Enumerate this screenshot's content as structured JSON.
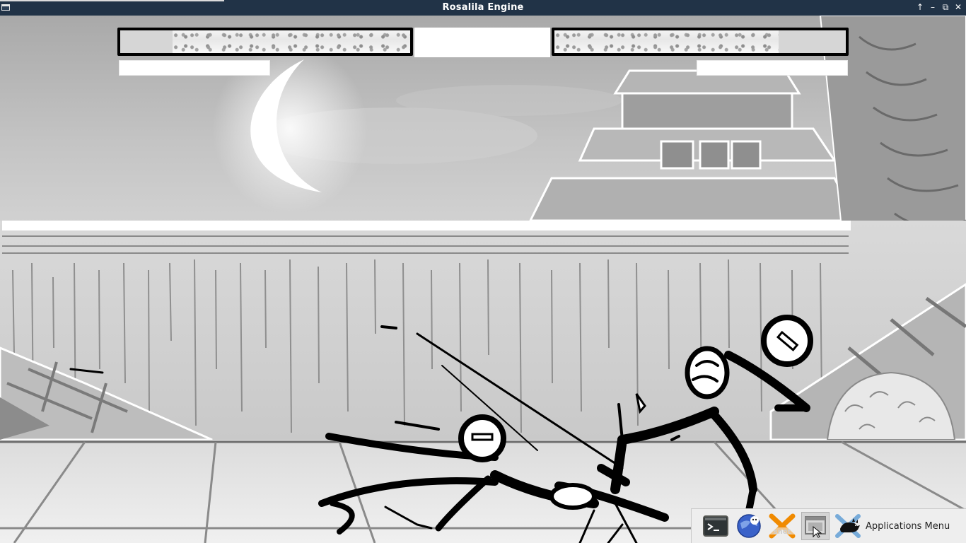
{
  "window": {
    "title": "Rosalila Engine",
    "controls": {
      "up_glyph": "↑",
      "minimize_glyph": "–",
      "maximize_glyph": "⧉",
      "close_glyph": "✕"
    }
  },
  "hud": {
    "p1_health_fraction": 0.82,
    "p2_health_fraction": 0.77
  },
  "taskbar": {
    "items": [
      {
        "icon": "terminal-icon"
      },
      {
        "icon": "web-browser-icon"
      },
      {
        "icon": "screenshot-tool-icon"
      },
      {
        "icon": "window-switcher-icon",
        "active": true
      }
    ],
    "apps_menu_label": "Applications Menu",
    "apps_menu_icon": "xfce-mouse-icon"
  },
  "colors": {
    "titlebar": "#213347",
    "taskbar": "#eeeeee",
    "accent_orange": "#f08a00"
  }
}
